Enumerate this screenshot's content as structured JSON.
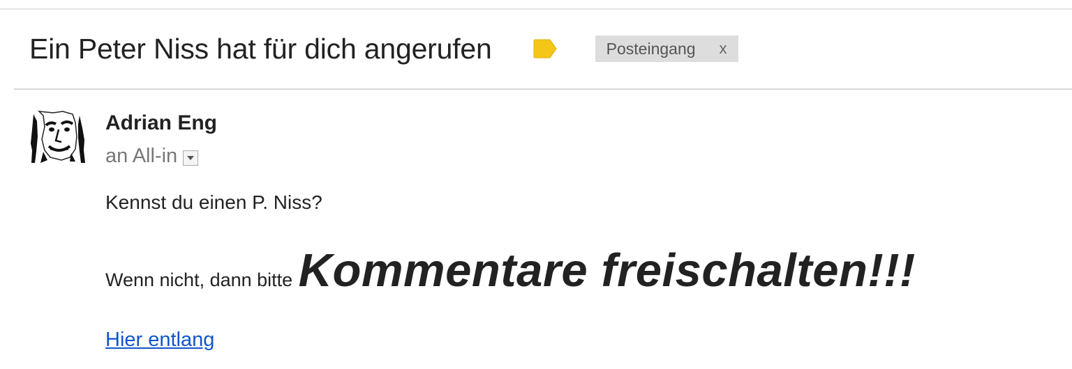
{
  "email": {
    "subject": "Ein Peter Niss hat für dich angerufen",
    "label_color": "#f5c518",
    "label_chip": {
      "text": "Posteingang",
      "remove": "x"
    },
    "sender": "Adrian Eng",
    "recipient": "an All-in",
    "body": {
      "line1": "Kennst du einen P. Niss?",
      "line2_prefix": "Wenn nicht, dann bitte",
      "line2_emphasis": "Kommentare freischalten!!!",
      "link_text": "Hier entlang"
    }
  },
  "colors": {
    "link": "#1155cc",
    "chip_bg": "#dddddd",
    "text": "#222222",
    "muted": "#777777"
  }
}
